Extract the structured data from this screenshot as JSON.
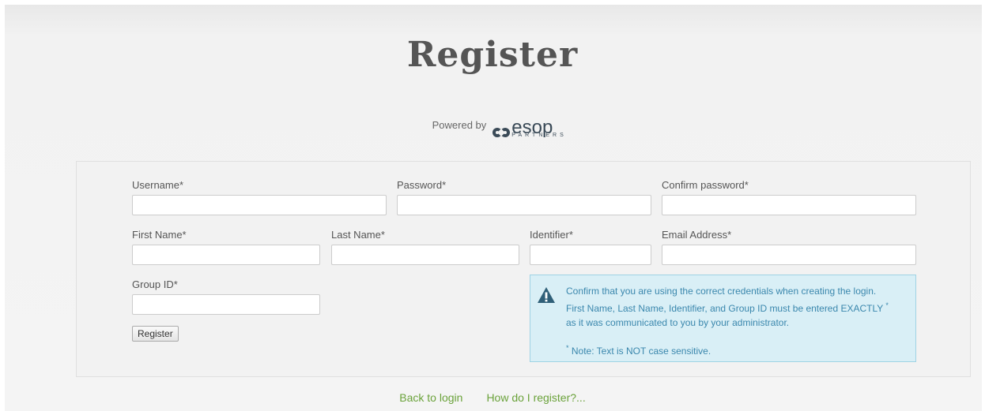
{
  "header": {
    "title": "Register",
    "powered_by": "Powered by",
    "brand_name": "esop",
    "brand_sub": "PARTNERS"
  },
  "form": {
    "username_label": "Username*",
    "password_label": "Password*",
    "confirm_password_label": "Confirm password*",
    "first_name_label": "First Name*",
    "last_name_label": "Last Name*",
    "identifier_label": "Identifier*",
    "email_label": "Email Address*",
    "group_id_label": "Group ID*",
    "register_button": "Register"
  },
  "alert": {
    "line1": "Confirm that you are using the correct credentials when creating the login.",
    "line2": "First Name, Last Name, Identifier, and Group ID must be entered EXACTLY",
    "line3": "as it was communicated to you by your administrator.",
    "star": "*",
    "note": "Note: Text is NOT case sensitive.",
    "icon": "warning-icon"
  },
  "footer": {
    "back_to_login": "Back to login",
    "how_register": "How do I register?..."
  },
  "colors": {
    "link": "#6aa23a",
    "alert_bg": "#d9eff6",
    "alert_text": "#3a87ad",
    "brand": "#3a4a57"
  }
}
